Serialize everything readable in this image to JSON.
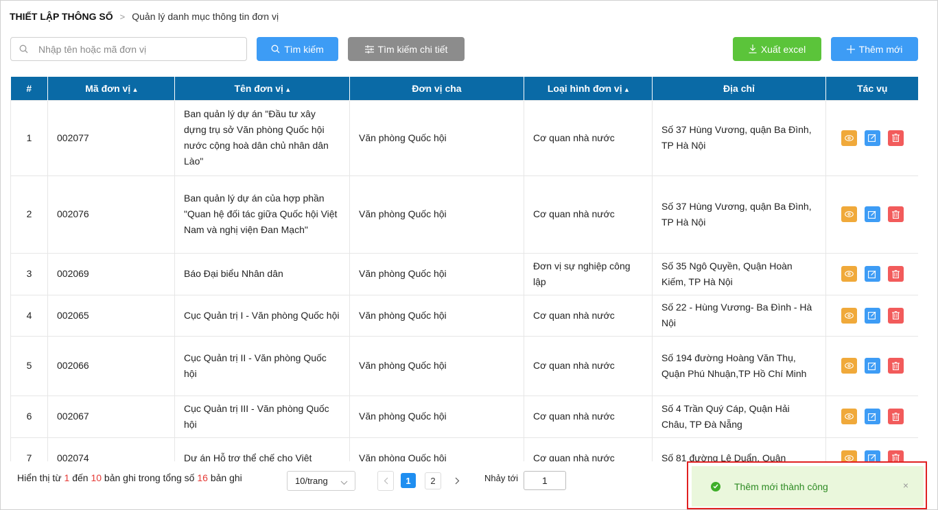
{
  "breadcrumb": {
    "root": "THIẾT LẬP THÔNG SỐ",
    "separator": ">",
    "current": "Quản lý danh mục thông tin đơn vị"
  },
  "search": {
    "placeholder": "Nhập tên hoặc mã đơn vị",
    "value": ""
  },
  "toolbar": {
    "search_label": "Tìm kiếm",
    "advanced_label": "Tìm kiếm chi tiết",
    "excel_label": "Xuất excel",
    "add_label": "Thêm mới"
  },
  "colors": {
    "header": "#0a6aa6",
    "primary": "#3d9cf5",
    "success": "#5bc43a",
    "warning": "#f0a93a",
    "danger": "#f25b5b",
    "neutral": "#8c8c8c"
  },
  "table": {
    "headers": {
      "index": "#",
      "code": "Mã đơn vị",
      "name": "Tên đơn vị",
      "parent": "Đơn vị cha",
      "type": "Loại hình đơn vị",
      "address": "Địa chỉ",
      "actions": "Tác vụ"
    },
    "rows": [
      {
        "index": "1",
        "code": "002077",
        "name": "Ban quản lý dự án \"Đầu tư xây dựng trụ sở Văn phòng Quốc hội nước cộng hoà dân chủ nhân dân Lào\"",
        "parent": "Văn phòng Quốc hội",
        "type": "Cơ quan nhà nước",
        "address": "Số 37 Hùng Vương, quận Ba Đình, TP Hà Nội"
      },
      {
        "index": "2",
        "code": "002076",
        "name": "Ban quản lý dự án của hợp phần \"Quan hệ đối tác giữa Quốc hội Việt Nam và nghị viện Đan Mạch\"",
        "parent": "Văn phòng Quốc hội",
        "type": "Cơ quan nhà nước",
        "address": "Số 37 Hùng Vương, quận Ba Đình, TP Hà Nội"
      },
      {
        "index": "3",
        "code": "002069",
        "name": "Báo Đại biểu Nhân dân",
        "parent": "Văn phòng Quốc hội",
        "type": "Đơn vị sự nghiệp công lập",
        "address": "Số 35 Ngô Quyền, Quận Hoàn Kiếm, TP Hà Nội"
      },
      {
        "index": "4",
        "code": "002065",
        "name": "Cục Quản trị I - Văn phòng Quốc hội",
        "parent": "Văn phòng Quốc hội",
        "type": "Cơ quan nhà nước",
        "address": "Số 22 - Hùng Vương- Ba Đình - Hà Nội"
      },
      {
        "index": "5",
        "code": "002066",
        "name": "Cục Quản trị II - Văn phòng Quốc hội",
        "parent": "Văn phòng Quốc hội",
        "type": "Cơ quan nhà nước",
        "address": "Số 194 đường Hoàng Văn Thụ, Quận Phú Nhuận,TP Hồ Chí Minh"
      },
      {
        "index": "6",
        "code": "002067",
        "name": "Cục Quản trị III - Văn phòng Quốc hội",
        "parent": "Văn phòng Quốc hội",
        "type": "Cơ quan nhà nước",
        "address": "Số 4 Trần Quý Cáp, Quận Hải Châu, TP Đà Nẵng"
      },
      {
        "index": "7",
        "code": "002074",
        "name": "Dự án Hỗ trợ thể chế cho Việt",
        "parent": "Văn phòng Quốc hội",
        "type": "Cơ quan nhà nước",
        "address": "Số 81 đường Lê Duẩn, Quận"
      }
    ]
  },
  "pagination": {
    "info_prefix": "Hiển thị từ",
    "from": "1",
    "info_mid1": "đến",
    "to": "10",
    "info_mid2": "bản ghi trong tổng số",
    "total": "16",
    "info_suffix": "bản ghi",
    "page_size": "10/trang",
    "pages": [
      "1",
      "2"
    ],
    "current_page": "1",
    "jump_label": "Nhảy tới",
    "jump_value": "1"
  },
  "toast": {
    "message": "Thêm mới thành công",
    "close": "×"
  }
}
